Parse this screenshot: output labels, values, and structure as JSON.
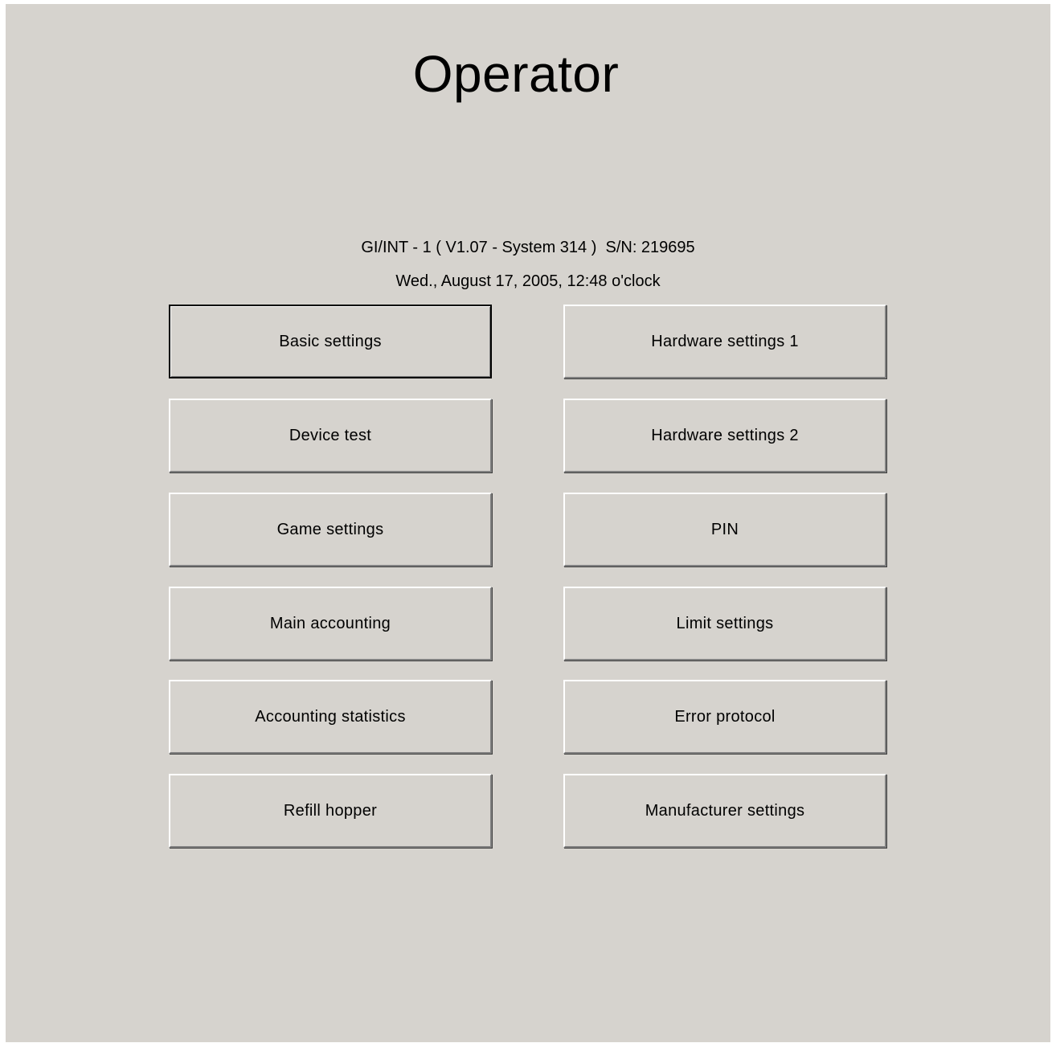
{
  "title": "Operator",
  "info": {
    "version_line": "GI/INT - 1 ( V1.07 - System 314 )  S/N: 219695",
    "datetime_line": "Wed., August 17, 2005, 12:48 o'clock"
  },
  "buttons": {
    "left": [
      {
        "label": "Basic settings"
      },
      {
        "label": "Device test"
      },
      {
        "label": "Game settings"
      },
      {
        "label": "Main accounting"
      },
      {
        "label": "Accounting statistics"
      },
      {
        "label": "Refill hopper"
      }
    ],
    "right": [
      {
        "label": "Hardware settings 1"
      },
      {
        "label": "Hardware settings 2"
      },
      {
        "label": "PIN"
      },
      {
        "label": "Limit settings"
      },
      {
        "label": "Error protocol"
      },
      {
        "label": "Manufacturer settings"
      }
    ]
  },
  "colors": {
    "background": "#d6d3ce",
    "text": "#000000"
  }
}
